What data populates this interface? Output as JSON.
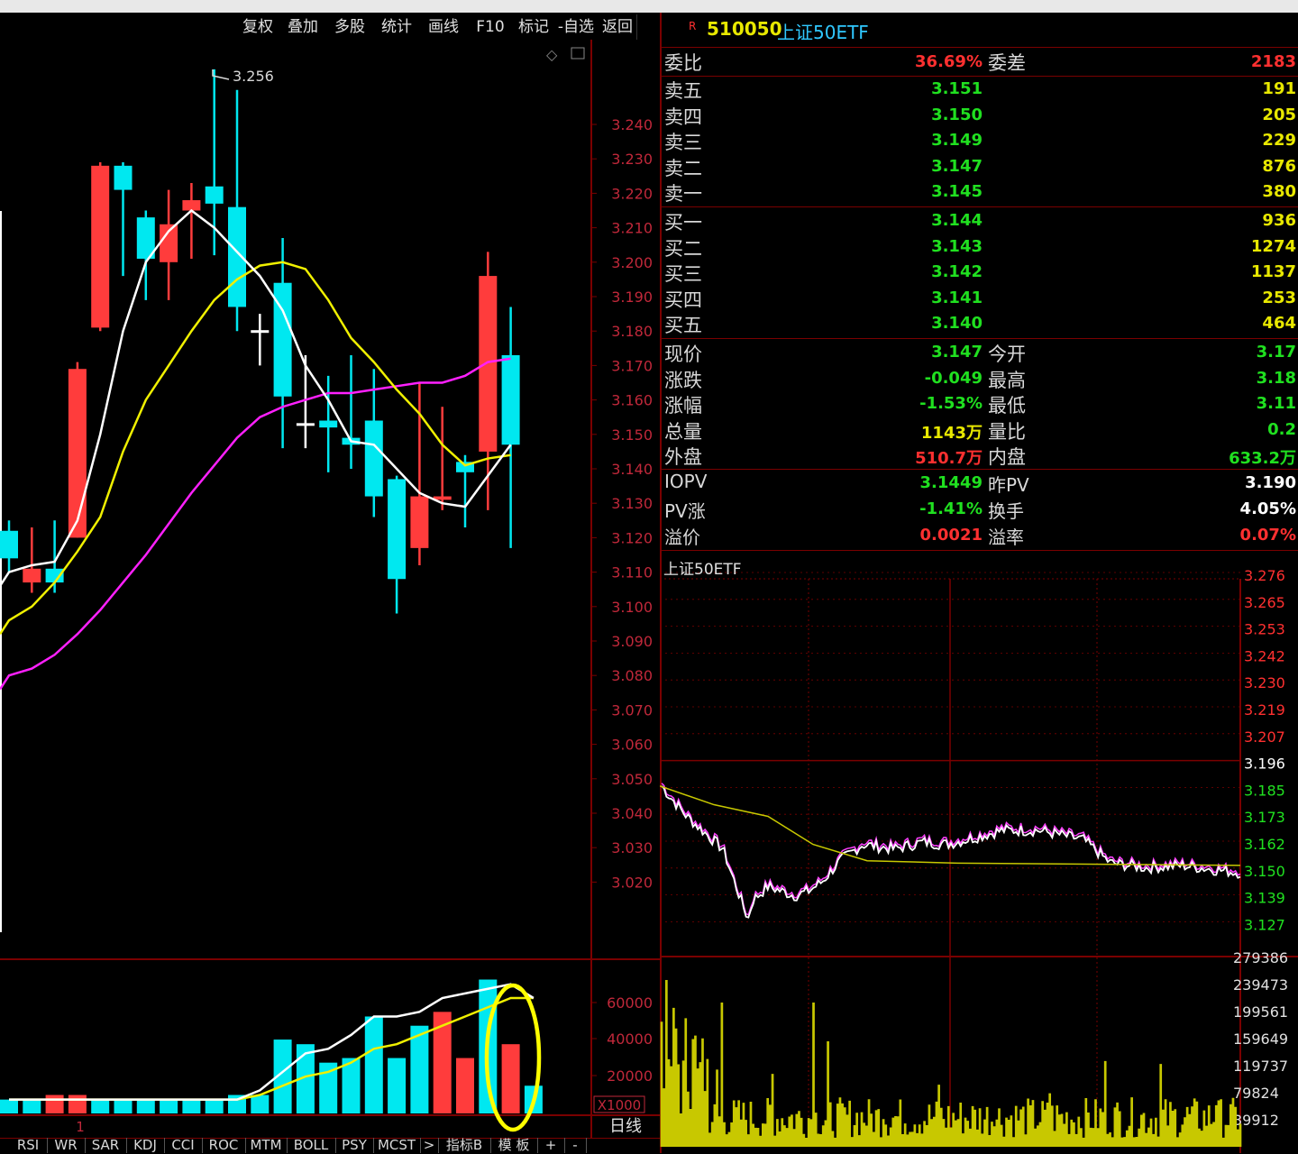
{
  "toolbar": {
    "buttons": [
      "复权",
      "叠加",
      "多股",
      "统计",
      "画线",
      "F10",
      "标记",
      "-自选",
      "返回"
    ]
  },
  "kline": {
    "price_axis": [
      "3.240",
      "3.230",
      "3.220",
      "3.210",
      "3.200",
      "3.190",
      "3.180",
      "3.170",
      "3.160",
      "3.150",
      "3.140",
      "3.130",
      "3.120",
      "3.110",
      "3.100",
      "3.090",
      "3.080",
      "3.070",
      "3.060",
      "3.050",
      "3.040",
      "3.030",
      "3.020"
    ],
    "high_marker": "3.256",
    "vol_axis": [
      "60000",
      "40000",
      "20000"
    ],
    "vol_unit": "X1000",
    "period": "日线",
    "cursor_label": "1",
    "candles": [
      {
        "o": 3.114,
        "c": 3.122,
        "h": 3.125,
        "l": 3.11,
        "up": false
      },
      {
        "o": 3.107,
        "c": 3.111,
        "h": 3.123,
        "l": 3.104,
        "up": true
      },
      {
        "o": 3.111,
        "c": 3.107,
        "h": 3.125,
        "l": 3.104,
        "up": false
      },
      {
        "o": 3.12,
        "c": 3.169,
        "h": 3.171,
        "l": 3.12,
        "up": true
      },
      {
        "o": 3.181,
        "c": 3.228,
        "h": 3.229,
        "l": 3.18,
        "up": true
      },
      {
        "o": 3.228,
        "c": 3.221,
        "h": 3.229,
        "l": 3.196,
        "up": false
      },
      {
        "o": 3.213,
        "c": 3.201,
        "h": 3.215,
        "l": 3.189,
        "up": false
      },
      {
        "o": 3.2,
        "c": 3.211,
        "h": 3.221,
        "l": 3.189,
        "up": true
      },
      {
        "o": 3.215,
        "c": 3.218,
        "h": 3.223,
        "l": 3.201,
        "up": true
      },
      {
        "o": 3.222,
        "c": 3.217,
        "h": 3.256,
        "l": 3.202,
        "up": false
      },
      {
        "o": 3.216,
        "c": 3.187,
        "h": 3.25,
        "l": 3.18,
        "up": false
      },
      {
        "o": 3.18,
        "c": 3.18,
        "h": 3.185,
        "l": 3.17,
        "up": true
      },
      {
        "o": 3.194,
        "c": 3.161,
        "h": 3.207,
        "l": 3.146,
        "up": false
      },
      {
        "o": 3.153,
        "c": 3.153,
        "h": 3.173,
        "l": 3.146,
        "up": true
      },
      {
        "o": 3.152,
        "c": 3.154,
        "h": 3.167,
        "l": 3.139,
        "up": false
      },
      {
        "o": 3.147,
        "c": 3.149,
        "h": 3.173,
        "l": 3.14,
        "up": false
      },
      {
        "o": 3.154,
        "c": 3.132,
        "h": 3.169,
        "l": 3.126,
        "up": false
      },
      {
        "o": 3.137,
        "c": 3.108,
        "h": 3.138,
        "l": 3.098,
        "up": false
      },
      {
        "o": 3.117,
        "c": 3.132,
        "h": 3.165,
        "l": 3.112,
        "up": true
      },
      {
        "o": 3.132,
        "c": 3.131,
        "h": 3.158,
        "l": 3.128,
        "up": true
      },
      {
        "o": 3.142,
        "c": 3.139,
        "h": 3.144,
        "l": 3.123,
        "up": false
      },
      {
        "o": 3.145,
        "c": 3.196,
        "h": 3.203,
        "l": 3.128,
        "up": true
      },
      {
        "o": 3.173,
        "c": 3.147,
        "h": 3.187,
        "l": 3.117,
        "up": false
      }
    ],
    "ma5": [
      3.11,
      3.112,
      3.113,
      3.125,
      3.15,
      3.18,
      3.2,
      3.209,
      3.215,
      3.21,
      3.203,
      3.196,
      3.186,
      3.17,
      3.16,
      3.148,
      3.147,
      3.14,
      3.133,
      3.13,
      3.129,
      3.138,
      3.147
    ],
    "ma10": [
      3.096,
      3.1,
      3.107,
      3.116,
      3.126,
      3.145,
      3.16,
      3.17,
      3.18,
      3.189,
      3.195,
      3.199,
      3.2,
      3.198,
      3.189,
      3.178,
      3.171,
      3.163,
      3.156,
      3.147,
      3.141,
      3.143,
      3.144
    ],
    "ma20": [
      3.08,
      3.082,
      3.086,
      3.092,
      3.099,
      3.107,
      3.115,
      3.124,
      3.133,
      3.141,
      3.149,
      3.155,
      3.158,
      3.16,
      3.162,
      3.162,
      3.163,
      3.164,
      3.165,
      3.165,
      3.167,
      3.171,
      3.172
    ],
    "volumes": [
      3,
      3,
      4,
      4,
      3,
      3,
      3,
      3,
      3,
      3,
      4,
      4,
      16,
      15,
      11,
      12,
      21,
      12,
      19,
      22,
      12,
      29,
      15,
      6
    ],
    "vol_up": [
      false,
      false,
      true,
      true,
      false,
      false,
      false,
      false,
      false,
      false,
      false,
      false,
      false,
      false,
      false,
      false,
      false,
      false,
      false,
      true,
      true,
      false,
      true,
      false
    ],
    "vol_ma1": [
      3,
      3,
      3,
      3,
      3,
      3,
      3,
      3,
      3,
      3,
      3,
      5,
      9,
      13,
      14,
      17,
      21,
      21,
      22,
      25,
      26,
      27,
      28,
      25
    ],
    "vol_ma2": [
      3,
      3,
      3,
      3,
      3,
      3,
      3,
      3,
      3,
      3,
      3,
      4,
      6,
      8,
      9,
      11,
      14,
      15,
      17,
      19,
      21,
      23,
      25,
      25
    ]
  },
  "tabs": [
    "RSI",
    "WR",
    "SAR",
    "KDJ",
    "CCI",
    "ROC",
    "MTM",
    "BOLL",
    "PSY",
    "MCST",
    ">",
    "指标B",
    "模 板",
    "+",
    "-"
  ],
  "quote": {
    "badge": "R",
    "code": "510050",
    "name": "上证50ETF",
    "weibi_label": "委比",
    "weibi": "36.69%",
    "weicha_label": "委差",
    "weicha": "2183",
    "asks": [
      {
        "label": "卖五",
        "price": "3.151",
        "vol": "191"
      },
      {
        "label": "卖四",
        "price": "3.150",
        "vol": "205"
      },
      {
        "label": "卖三",
        "price": "3.149",
        "vol": "229"
      },
      {
        "label": "卖二",
        "price": "3.147",
        "vol": "876"
      },
      {
        "label": "卖一",
        "price": "3.145",
        "vol": "380"
      }
    ],
    "bids": [
      {
        "label": "买一",
        "price": "3.144",
        "vol": "936"
      },
      {
        "label": "买二",
        "price": "3.143",
        "vol": "1274"
      },
      {
        "label": "买三",
        "price": "3.142",
        "vol": "1137"
      },
      {
        "label": "买四",
        "price": "3.141",
        "vol": "253"
      },
      {
        "label": "买五",
        "price": "3.140",
        "vol": "464"
      }
    ],
    "stats": [
      {
        "l1": "现价",
        "v1": "3.147",
        "c1": "#20e020",
        "l2": "今开",
        "v2": "3.17",
        "c2": "#20e020"
      },
      {
        "l1": "涨跌",
        "v1": "-0.049",
        "c1": "#20e020",
        "l2": "最高",
        "v2": "3.18",
        "c2": "#20e020"
      },
      {
        "l1": "涨幅",
        "v1": "-1.53%",
        "c1": "#20e020",
        "l2": "最低",
        "v2": "3.11",
        "c2": "#20e020"
      },
      {
        "l1": "总量",
        "v1": "1143万",
        "c1": "#e8e800",
        "l2": "量比",
        "v2": "0.2",
        "c2": "#20e020"
      },
      {
        "l1": "外盘",
        "v1": "510.7万",
        "c1": "#ff3030",
        "l2": "内盘",
        "v2": "633.2万",
        "c2": "#20e020"
      }
    ],
    "iopv": [
      {
        "l1": "IOPV",
        "v1": "3.1449",
        "c1": "#20e020",
        "l2": "昨PV",
        "v2": "3.190",
        "c2": "#ffffff"
      },
      {
        "l1": "PV涨",
        "v1": "-1.41%",
        "c1": "#20e020",
        "l2": "换手",
        "v2": "4.05%",
        "c2": "#ffffff"
      },
      {
        "l1": "溢价",
        "v1": "0.0021",
        "c1": "#ff3030",
        "l2": "溢率",
        "v2": "0.07%",
        "c2": "#ff3030"
      }
    ]
  },
  "intraday": {
    "title": "上证50ETF",
    "price_axis": [
      {
        "v": "3.276",
        "c": "#ff3030"
      },
      {
        "v": "3.265",
        "c": "#ff3030"
      },
      {
        "v": "3.253",
        "c": "#ff3030"
      },
      {
        "v": "3.242",
        "c": "#ff3030"
      },
      {
        "v": "3.230",
        "c": "#ff3030"
      },
      {
        "v": "3.219",
        "c": "#ff3030"
      },
      {
        "v": "3.207",
        "c": "#ff3030"
      },
      {
        "v": "3.196",
        "c": "#ffffff"
      },
      {
        "v": "3.185",
        "c": "#20e020"
      },
      {
        "v": "3.173",
        "c": "#20e020"
      },
      {
        "v": "3.162",
        "c": "#20e020"
      },
      {
        "v": "3.150",
        "c": "#20e020"
      },
      {
        "v": "3.139",
        "c": "#20e020"
      },
      {
        "v": "3.127",
        "c": "#20e020"
      }
    ],
    "vol_axis": [
      "279386",
      "239473",
      "199561",
      "159649",
      "119737",
      "79824",
      "39912"
    ]
  },
  "colors": {
    "up": "#ff3c3c",
    "down": "#00e8f0",
    "ma5": "#ffffff",
    "ma10": "#f0f000",
    "ma20": "#ff20ff",
    "grid": "#7a0000",
    "highlight": "#ffff00"
  }
}
